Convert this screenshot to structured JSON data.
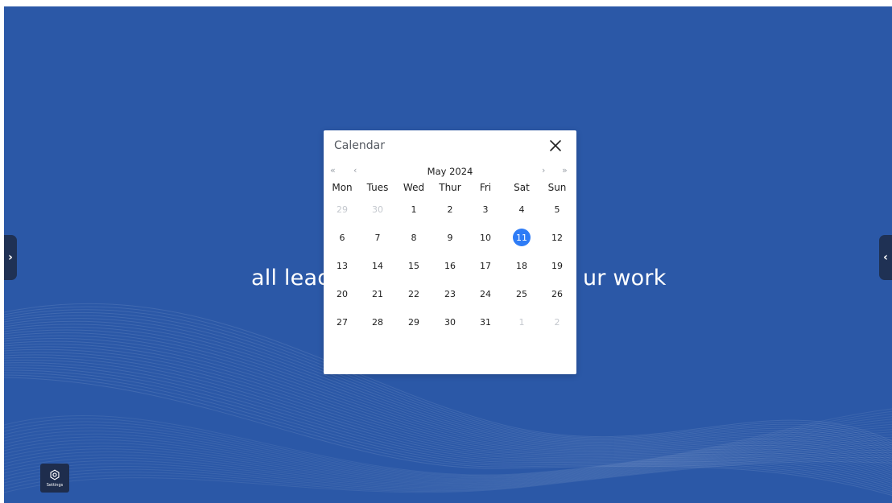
{
  "background": {
    "color": "#2b58a7",
    "text_left": "all lead",
    "text_right": "ur work"
  },
  "edge_tabs": {
    "left_icon": "chevron-right-icon",
    "left_glyph": "›",
    "right_icon": "chevron-left-icon",
    "right_glyph": "‹"
  },
  "settings": {
    "label": "Settings",
    "icon": "gear-icon"
  },
  "calendar": {
    "title": "Calendar",
    "close_icon": "close-icon",
    "month_label": "May 2024",
    "nav": {
      "prev_year": "«",
      "prev_month": "‹",
      "next_month": "›",
      "next_year": "»"
    },
    "weekdays": [
      "Mon",
      "Tues",
      "Wed",
      "Thur",
      "Fri",
      "Sat",
      "Sun"
    ],
    "weeks": [
      [
        {
          "d": "29",
          "other": true
        },
        {
          "d": "30",
          "other": true
        },
        {
          "d": "1"
        },
        {
          "d": "2"
        },
        {
          "d": "3"
        },
        {
          "d": "4"
        },
        {
          "d": "5"
        }
      ],
      [
        {
          "d": "6"
        },
        {
          "d": "7"
        },
        {
          "d": "8"
        },
        {
          "d": "9"
        },
        {
          "d": "10"
        },
        {
          "d": "11",
          "selected": true
        },
        {
          "d": "12"
        }
      ],
      [
        {
          "d": "13"
        },
        {
          "d": "14"
        },
        {
          "d": "15"
        },
        {
          "d": "16"
        },
        {
          "d": "17"
        },
        {
          "d": "18"
        },
        {
          "d": "19"
        }
      ],
      [
        {
          "d": "20"
        },
        {
          "d": "21"
        },
        {
          "d": "22"
        },
        {
          "d": "23"
        },
        {
          "d": "24"
        },
        {
          "d": "25"
        },
        {
          "d": "26"
        }
      ],
      [
        {
          "d": "27"
        },
        {
          "d": "28"
        },
        {
          "d": "29"
        },
        {
          "d": "30"
        },
        {
          "d": "31"
        },
        {
          "d": "1",
          "other": true
        },
        {
          "d": "2",
          "other": true
        }
      ]
    ],
    "selected_color": "#2e7cf6"
  }
}
